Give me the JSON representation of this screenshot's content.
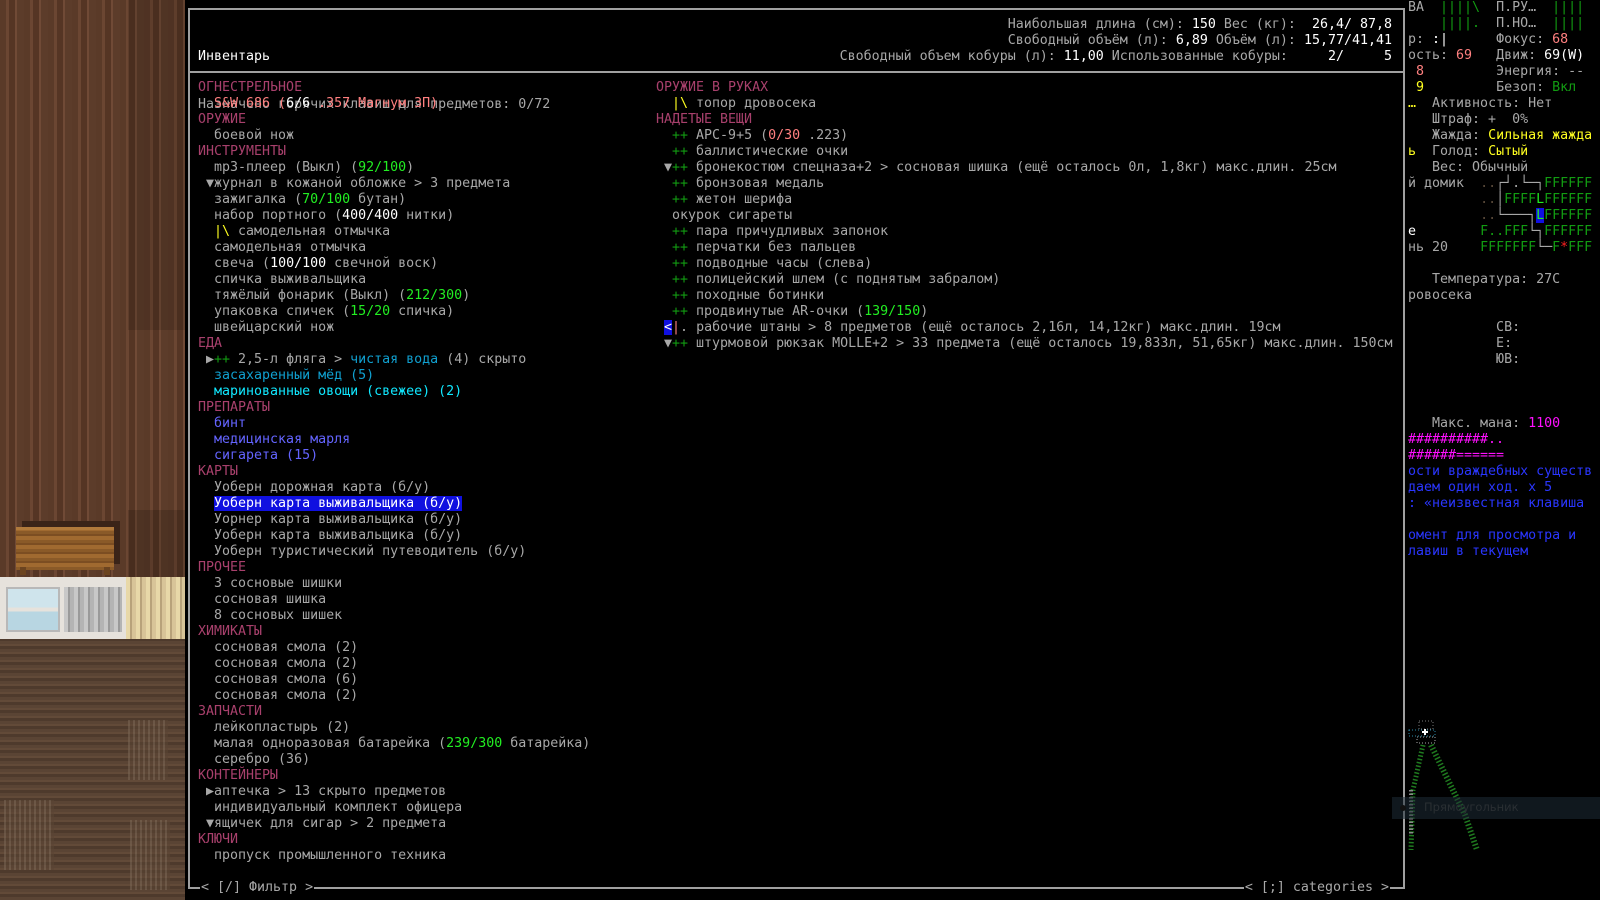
{
  "colors": {
    "g": "#a8a8a8",
    "w": "#ffffff",
    "h": "#a8406c",
    "s": "#ff8080",
    "gr": "#22ee22",
    "dg": "#129c12",
    "y": "#ffff20",
    "dc": "#10a0d0",
    "c": "#10e8ff",
    "b": "#6464ff",
    "m": "#ff10ff",
    "bl": "#2a36ff",
    "dim": "#5a4a3a",
    "r": "#ff2020",
    "sel": "#1010e0"
  },
  "header": {
    "title": "Инвентарь",
    "hotkeys": [
      [
        "Назначено горячих клавиш для предметов: ",
        "g"
      ],
      [
        "0/72",
        "g"
      ]
    ],
    "stats": [
      [
        [
          "Наибольшая длина (см): ",
          "g"
        ],
        [
          "150",
          "w"
        ],
        [
          " Вес (кг): ",
          "g"
        ],
        [
          " 26,4/ 87,8",
          "w"
        ]
      ],
      [
        [
          "Свободный объём (л): ",
          "g"
        ],
        [
          "6,89",
          "w"
        ],
        [
          " Объём (л): ",
          "g"
        ],
        [
          "15,77/41,41",
          "w"
        ]
      ],
      [
        [
          "Свободный объем кобуры (л): ",
          "g"
        ],
        [
          "11,00",
          "w"
        ],
        [
          " Использованные кобуры: ",
          "g"
        ],
        [
          "    2/     5",
          "w"
        ]
      ]
    ]
  },
  "left": {
    "lines": [
      {
        "h": true,
        "segs": [
          [
            "ОГНЕСТРЕЛЬНОЕ",
            "h"
          ]
        ]
      },
      {
        "segs": [
          [
            "  S&W 686 (",
            "s"
          ],
          [
            "6/6",
            "w"
          ],
          [
            " .357 Магнум ЗП)",
            "s"
          ]
        ]
      },
      {
        "h": true,
        "segs": [
          [
            "ОРУЖИЕ",
            "h"
          ]
        ]
      },
      {
        "segs": [
          [
            "  боевой нож",
            "g"
          ]
        ]
      },
      {
        "h": true,
        "segs": [
          [
            "ИНСТРУМЕНТЫ",
            "h"
          ]
        ]
      },
      {
        "segs": [
          [
            "  mp3-плеер (Выкл) (",
            "g"
          ],
          [
            "92/100",
            "gr"
          ],
          [
            ")",
            "g"
          ]
        ]
      },
      {
        "segs": [
          [
            " ▼журнал в кожаной обложке > 3 предмета",
            "g"
          ]
        ]
      },
      {
        "segs": [
          [
            "  зажигалка (",
            "g"
          ],
          [
            "70/100",
            "gr"
          ],
          [
            " бутан)",
            "g"
          ]
        ]
      },
      {
        "segs": [
          [
            "  набор портного (",
            "g"
          ],
          [
            "400/400",
            "w"
          ],
          [
            " нитки)",
            "g"
          ]
        ]
      },
      {
        "segs": [
          [
            "  ",
            "g"
          ],
          [
            "|\\",
            "y"
          ],
          [
            " самодельная отмычка",
            "g"
          ]
        ]
      },
      {
        "segs": [
          [
            "  самодельная отмычка",
            "g"
          ]
        ]
      },
      {
        "segs": [
          [
            "  свеча (",
            "g"
          ],
          [
            "100/100",
            "w"
          ],
          [
            " свечной воск)",
            "g"
          ]
        ]
      },
      {
        "segs": [
          [
            "  спичка выживальщика",
            "g"
          ]
        ]
      },
      {
        "segs": [
          [
            "  тяжёлый фонарик (Выкл) (",
            "g"
          ],
          [
            "212/300",
            "gr"
          ],
          [
            ")",
            "g"
          ]
        ]
      },
      {
        "segs": [
          [
            "  упаковка спичек (",
            "g"
          ],
          [
            "15/20",
            "gr"
          ],
          [
            " спичка)",
            "g"
          ]
        ]
      },
      {
        "segs": [
          [
            "  швейцарский нож",
            "g"
          ]
        ]
      },
      {
        "h": true,
        "segs": [
          [
            "ЕДА",
            "h"
          ]
        ]
      },
      {
        "segs": [
          [
            " ▶",
            "g"
          ],
          [
            "++",
            "dg"
          ],
          [
            " 2,5-л фляга > ",
            "g"
          ],
          [
            "чистая вода",
            "dc"
          ],
          [
            " (4) скрыто",
            "g"
          ]
        ]
      },
      {
        "segs": [
          [
            "  засахаренный мёд (5)",
            "dc"
          ]
        ]
      },
      {
        "segs": [
          [
            "  маринованные овощи (свежее) (2)",
            "c"
          ]
        ]
      },
      {
        "h": true,
        "segs": [
          [
            "ПРЕПАРАТЫ",
            "h"
          ]
        ]
      },
      {
        "segs": [
          [
            "  бинт",
            "b"
          ]
        ]
      },
      {
        "segs": [
          [
            "  медицинская марля",
            "b"
          ]
        ]
      },
      {
        "segs": [
          [
            "  сигарета (15)",
            "b"
          ]
        ]
      },
      {
        "h": true,
        "segs": [
          [
            "КАРТЫ",
            "h"
          ]
        ]
      },
      {
        "segs": [
          [
            "  Уоберн дорожная карта (б/у)",
            "g"
          ]
        ]
      },
      {
        "sel": true,
        "segs": [
          [
            "  ",
            "g"
          ],
          [
            "Уоберн карта выживальщика (б/у)",
            "w"
          ]
        ]
      },
      {
        "segs": [
          [
            "  Уорнер карта выживальщика (б/у)",
            "g"
          ]
        ]
      },
      {
        "segs": [
          [
            "  Уоберн карта выживальщика (б/у)",
            "g"
          ]
        ]
      },
      {
        "segs": [
          [
            "  Уоберн туристический путеводитель (б/у)",
            "g"
          ]
        ]
      },
      {
        "h": true,
        "segs": [
          [
            "ПРОЧЕЕ",
            "h"
          ]
        ]
      },
      {
        "segs": [
          [
            "  3 сосновые шишки",
            "g"
          ]
        ]
      },
      {
        "segs": [
          [
            "  сосновая шишка",
            "g"
          ]
        ]
      },
      {
        "segs": [
          [
            "  8 сосновых шишек",
            "g"
          ]
        ]
      },
      {
        "h": true,
        "segs": [
          [
            "ХИМИКАТЫ",
            "h"
          ]
        ]
      },
      {
        "segs": [
          [
            "  сосновая смола (2)",
            "g"
          ]
        ]
      },
      {
        "segs": [
          [
            "  сосновая смола (2)",
            "g"
          ]
        ]
      },
      {
        "segs": [
          [
            "  сосновая смола (6)",
            "g"
          ]
        ]
      },
      {
        "segs": [
          [
            "  сосновая смола (2)",
            "g"
          ]
        ]
      },
      {
        "h": true,
        "segs": [
          [
            "ЗАПЧАСТИ",
            "h"
          ]
        ]
      },
      {
        "segs": [
          [
            "  лейкопластырь (2)",
            "g"
          ]
        ]
      },
      {
        "segs": [
          [
            "  малая одноразовая батарейка (",
            "g"
          ],
          [
            "239/300",
            "gr"
          ],
          [
            " батарейка)",
            "g"
          ]
        ]
      },
      {
        "segs": [
          [
            "  серебро (36)",
            "g"
          ]
        ]
      },
      {
        "h": true,
        "segs": [
          [
            "КОНТЕЙНЕРЫ",
            "h"
          ]
        ]
      },
      {
        "segs": [
          [
            " ▶аптечка > 13 скрыто предметов",
            "g"
          ]
        ]
      },
      {
        "segs": [
          [
            "  индивидуальный комплект офицера",
            "g"
          ]
        ]
      },
      {
        "segs": [
          [
            " ▼ящичек для сигар > 2 предмета",
            "g"
          ]
        ]
      },
      {
        "h": true,
        "segs": [
          [
            "КЛЮЧИ",
            "h"
          ]
        ]
      },
      {
        "segs": [
          [
            "  пропуск промышленного техника",
            "g"
          ]
        ]
      }
    ]
  },
  "right": {
    "lines": [
      {
        "h": true,
        "segs": [
          [
            "ОРУЖИЕ В РУКАХ",
            "h"
          ]
        ]
      },
      {
        "segs": [
          [
            "  ",
            "g"
          ],
          [
            "|\\",
            "y"
          ],
          [
            " топор дровосека",
            "g"
          ]
        ]
      },
      {
        "h": true,
        "segs": [
          [
            "НАДЕТЫЕ ВЕЩИ",
            "h"
          ]
        ]
      },
      {
        "segs": [
          [
            "  ",
            "g"
          ],
          [
            "++",
            "dg"
          ],
          [
            " APC-9+5 (",
            "g"
          ],
          [
            "0/30",
            "s"
          ],
          [
            " .223)",
            "g"
          ]
        ]
      },
      {
        "segs": [
          [
            "  ",
            "g"
          ],
          [
            "++",
            "dg"
          ],
          [
            " баллистические очки",
            "g"
          ]
        ]
      },
      {
        "segs": [
          [
            " ▼",
            "g"
          ],
          [
            "++",
            "dg"
          ],
          [
            " бронекостюм спецназа+2 > сосновая шишка (ещё осталось 0л, 1,8кг) макс.длин. 25см",
            "g"
          ]
        ]
      },
      {
        "segs": [
          [
            "  ",
            "g"
          ],
          [
            "++",
            "dg"
          ],
          [
            " бронзовая медаль",
            "g"
          ]
        ]
      },
      {
        "segs": [
          [
            "  ",
            "g"
          ],
          [
            "++",
            "dg"
          ],
          [
            " жетон шерифа",
            "g"
          ]
        ]
      },
      {
        "segs": [
          [
            "  окурок сигареты",
            "g"
          ]
        ]
      },
      {
        "segs": [
          [
            "  ",
            "g"
          ],
          [
            "++",
            "dg"
          ],
          [
            " пара причудливых запонок",
            "g"
          ]
        ]
      },
      {
        "segs": [
          [
            "  ",
            "g"
          ],
          [
            "++",
            "dg"
          ],
          [
            " перчатки без пальцев",
            "g"
          ]
        ]
      },
      {
        "segs": [
          [
            "  ",
            "g"
          ],
          [
            "++",
            "dg"
          ],
          [
            " подводные часы (слева)",
            "g"
          ]
        ]
      },
      {
        "segs": [
          [
            "  ",
            "g"
          ],
          [
            "++",
            "dg"
          ],
          [
            " полицейский шлем (с поднятым забралом)",
            "g"
          ]
        ]
      },
      {
        "segs": [
          [
            "  ",
            "g"
          ],
          [
            "++",
            "dg"
          ],
          [
            " походные ботинки",
            "g"
          ]
        ]
      },
      {
        "segs": [
          [
            "  ",
            "g"
          ],
          [
            "++",
            "dg"
          ],
          [
            " продвинутые AR-очки (",
            "g"
          ],
          [
            "139/150",
            "gr"
          ],
          [
            ")",
            "g"
          ]
        ]
      },
      {
        "segs": [
          [
            " ",
            "g"
          ],
          [
            "<",
            "w",
            "blue-bg"
          ],
          [
            "|",
            "s"
          ],
          [
            ".",
            "g"
          ],
          [
            " рабочие штаны > 8 предметов (ещё осталось 2,16л, 14,12кг) макс.длин. 19см",
            "g"
          ]
        ]
      },
      {
        "segs": [
          [
            " ▼",
            "g"
          ],
          [
            "++",
            "dg"
          ],
          [
            " штурмовой рюкзак MOLLE+2 > 33 предмета (ещё осталось 19,833л, 51,65кг) макс.длин. 150см",
            "g"
          ]
        ]
      }
    ]
  },
  "footer": {
    "filter": "< [/] Фильтр >",
    "categories": "< [;] categories >"
  },
  "sidebar": {
    "rows": [
      [
        [
          "ВА  ",
          "g"
        ],
        [
          "||||\\",
          "dg"
        ],
        [
          "  П.РУ…  ",
          "g"
        ],
        [
          "||||",
          "dg"
        ]
      ],
      [
        [
          "    ",
          "g"
        ],
        [
          "||||.",
          "dg"
        ],
        [
          "  П.НО…  ",
          "g"
        ],
        [
          "||||",
          "dg"
        ]
      ],
      [
        [
          "р: ",
          "g"
        ],
        [
          ":|",
          "w"
        ],
        [
          "      Фокус: ",
          "g"
        ],
        [
          "68",
          "s"
        ]
      ],
      [
        [
          "ость: ",
          "g"
        ],
        [
          "69",
          "s"
        ],
        [
          "   Движ: ",
          "g"
        ],
        [
          "69(W)",
          "w"
        ]
      ],
      [
        [
          " ",
          "g"
        ],
        [
          "8",
          "s"
        ],
        [
          "         Энергия: --",
          "g"
        ]
      ],
      [
        [
          " ",
          "g"
        ],
        [
          "9",
          "y"
        ],
        [
          "         Безоп: ",
          "g"
        ],
        [
          "Вкл",
          "dg"
        ]
      ],
      [
        [
          "…",
          "y"
        ],
        [
          "  Активность: Нет",
          "g"
        ]
      ],
      [
        [
          "   Штраф: +  0%",
          "g"
        ]
      ],
      [
        [
          "   Жажда: ",
          "g"
        ],
        [
          "Сильная жажда",
          "y"
        ]
      ],
      [
        [
          "ь",
          "y"
        ],
        [
          "  Голод: ",
          "g"
        ],
        [
          "Сытый",
          "y"
        ]
      ],
      [
        [
          "   Вес: Обычный",
          "g"
        ]
      ],
      [
        [
          "й домик  ",
          "g"
        ],
        [
          "..",
          "dim"
        ],
        [
          "┌┘.└─┐",
          "g"
        ],
        [
          "FFFFFF",
          "dg"
        ]
      ],
      [
        [
          "         ",
          "g"
        ],
        [
          "..",
          "dim"
        ],
        [
          "│",
          "g"
        ],
        [
          "FFFF",
          "dg"
        ],
        [
          "L",
          "gr"
        ],
        [
          "FFFFFF",
          "dg"
        ]
      ],
      [
        [
          "         ",
          "g"
        ],
        [
          "..",
          "dim"
        ],
        [
          "└───┐",
          "g"
        ],
        [
          "L",
          "gr",
          "blue-bg"
        ],
        [
          "FFFFFF",
          "dg"
        ]
      ],
      [
        [
          "е",
          "w"
        ],
        [
          "        ",
          "g"
        ],
        [
          "F..FFF",
          "dg"
        ],
        [
          "└┐",
          "g"
        ],
        [
          "FFFFFF",
          "dg"
        ]
      ],
      [
        [
          "нь 20    ",
          "g"
        ],
        [
          "FFFFFFF",
          "dg"
        ],
        [
          "└─",
          "g"
        ],
        [
          "F",
          "dg"
        ],
        [
          "*",
          "r"
        ],
        [
          "FFF",
          "dg"
        ]
      ],
      [],
      [
        [
          "   Температура: 27С",
          "g"
        ]
      ],
      [
        [
          "ровосека",
          "g"
        ]
      ],
      [],
      [
        [
          "           СВ:",
          "g"
        ]
      ],
      [
        [
          "           Е:",
          "g"
        ]
      ],
      [
        [
          "           ЮВ:",
          "g"
        ]
      ],
      [],
      [],
      [],
      [
        [
          "   Макс. мана: ",
          "g"
        ],
        [
          "1100",
          "m"
        ]
      ],
      [
        [
          "##########..",
          "m"
        ]
      ],
      [
        [
          "######======",
          "m"
        ]
      ],
      [
        [
          "ости враждебных существ",
          "bl"
        ]
      ],
      [
        [
          "даем один ход. x 5",
          "bl"
        ]
      ],
      [
        [
          ": «неизвестная клавиша",
          "bl"
        ]
      ],
      [],
      [
        [
          "омент для просмотра и",
          "bl"
        ]
      ],
      [
        [
          "лавиш в текущем",
          "bl"
        ]
      ]
    ]
  },
  "tooltip": {
    "label": "Прямоугольник"
  }
}
